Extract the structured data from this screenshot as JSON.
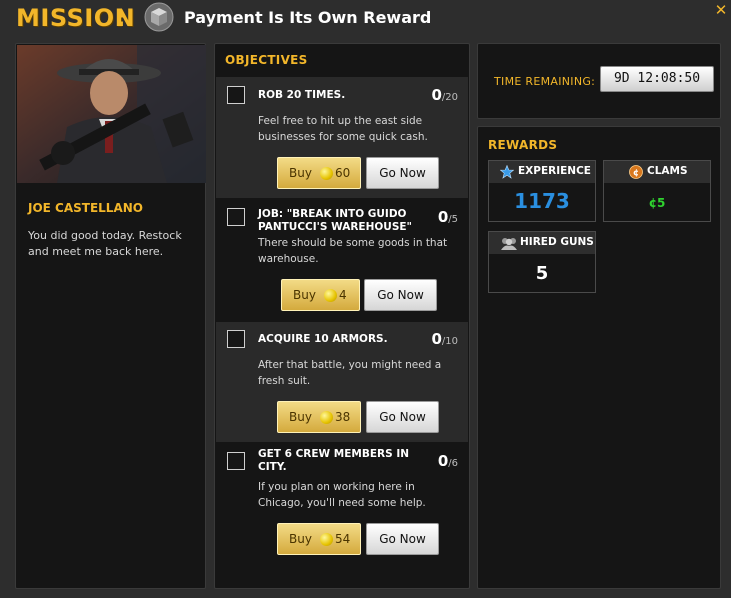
{
  "header": {
    "mission_word": "MISSION",
    "colon": ":",
    "title": "Payment Is Its Own Reward",
    "close_glyph": "✕"
  },
  "npc": {
    "name": "JOE CASTELLANO",
    "message": "You did good today. Restock and meet me back here."
  },
  "objectives": {
    "title": "OBJECTIVES",
    "buy_label": "Buy",
    "go_label": "Go Now",
    "items": [
      {
        "name": "ROB 20 TIMES.",
        "current": "0",
        "total": "/20",
        "desc": "Feel free to hit up the east side businesses for some quick cash.",
        "cost": "60"
      },
      {
        "name": "JOB: \"BREAK INTO GUIDO PANTUCCI'S WAREHOUSE\"",
        "current": "0",
        "total": "/5",
        "desc": "There should be some goods in that warehouse.",
        "cost": "4"
      },
      {
        "name": "ACQUIRE 10 ARMORS.",
        "current": "0",
        "total": "/10",
        "desc": "After that battle, you might need a fresh suit.",
        "cost": "38"
      },
      {
        "name": "GET 6 CREW MEMBERS IN CITY.",
        "current": "0",
        "total": "/6",
        "desc": "If you plan on working here in Chicago, you'll need some help.",
        "cost": "54"
      }
    ]
  },
  "timer": {
    "label": "TIME REMAINING:",
    "value": "9D 12:08:50"
  },
  "rewards": {
    "title": "REWARDS",
    "experience": {
      "label": "EXPERIENCE",
      "value": "1173",
      "color": "#2a8fe0",
      "icon": "star-icon"
    },
    "clams": {
      "label": "CLAMS",
      "value": "¢5",
      "color": "#2fd22f",
      "icon": "clam-icon"
    },
    "hired_guns": {
      "label": "HIRED GUNS",
      "value": "5",
      "color": "#ffffff",
      "icon": "hired-guns-icon"
    }
  },
  "colors": {
    "accent": "#f2b62a",
    "panel_bg": "#151515",
    "row_alt": "#2a2a2a"
  }
}
